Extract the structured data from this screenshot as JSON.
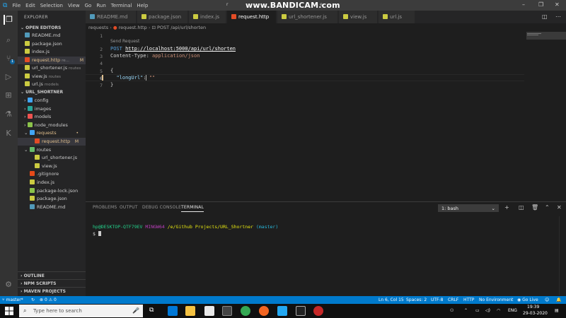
{
  "titlebar": {
    "menu": [
      "File",
      "Edit",
      "Selection",
      "View",
      "Go",
      "Run",
      "Terminal",
      "Help"
    ],
    "title_left": "r",
    "watermark": "www.BANDICAM.com",
    "title_right": "e",
    "minimize": "–",
    "maximize": "❐",
    "close": "✕"
  },
  "sidebar": {
    "header": "EXPLORER",
    "open_editors_title": "OPEN EDITORS",
    "open_editors": [
      {
        "name": "README.md",
        "detail": "",
        "icon_color": "#519aba",
        "mod": ""
      },
      {
        "name": "package.json",
        "detail": "",
        "icon_color": "#cbcb41",
        "mod": ""
      },
      {
        "name": "index.js",
        "detail": "",
        "icon_color": "#cbcb41",
        "mod": ""
      },
      {
        "name": "request.http",
        "detail": "re...",
        "icon_color": "#e34c26",
        "mod": "M"
      },
      {
        "name": "url_shortener.js",
        "detail": "routes",
        "icon_color": "#cbcb41",
        "mod": ""
      },
      {
        "name": "view.js",
        "detail": "routes",
        "icon_color": "#cbcb41",
        "mod": ""
      },
      {
        "name": "url.js",
        "detail": "models",
        "icon_color": "#cbcb41",
        "mod": ""
      }
    ],
    "project_title": "URL_SHORTNER",
    "tree": [
      {
        "name": "config",
        "icon_color": "#42a5f5",
        "mod": ""
      },
      {
        "name": "images",
        "icon_color": "#26a69a",
        "mod": ""
      },
      {
        "name": "models",
        "icon_color": "#ef5350",
        "mod": ""
      },
      {
        "name": "node_modules",
        "icon_color": "#8bc34a",
        "mod": ""
      },
      {
        "name": "requests",
        "icon_color": "#42a5f5",
        "mod": "•"
      },
      {
        "name": "request.http",
        "icon_color": "#e34c26",
        "mod": "M"
      },
      {
        "name": "routes",
        "icon_color": "#66bb6a",
        "mod": ""
      },
      {
        "name": "url_shortener.js",
        "icon_color": "#cbcb41",
        "mod": ""
      },
      {
        "name": "view.js",
        "icon_color": "#cbcb41",
        "mod": ""
      },
      {
        "name": ".gitignore",
        "icon_color": "#e64a19",
        "mod": ""
      },
      {
        "name": "index.js",
        "icon_color": "#cbcb41",
        "mod": ""
      },
      {
        "name": "package-lock.json",
        "icon_color": "#8bc34a",
        "mod": ""
      },
      {
        "name": "package.json",
        "icon_color": "#cbcb41",
        "mod": ""
      },
      {
        "name": "README.md",
        "icon_color": "#519aba",
        "mod": ""
      }
    ],
    "bottom_sections": [
      "OUTLINE",
      "NPM SCRIPTS",
      "MAVEN PROJECTS"
    ]
  },
  "tabs": [
    {
      "label": "README.md",
      "icon_color": "#519aba",
      "active": false
    },
    {
      "label": "package.json",
      "icon_color": "#cbcb41",
      "active": false
    },
    {
      "label": "index.js",
      "icon_color": "#cbcb41",
      "active": false
    },
    {
      "label": "request.http",
      "icon_color": "#e34c26",
      "active": true
    },
    {
      "label": "url_shortener.js",
      "icon_color": "#cbcb41",
      "active": false
    },
    {
      "label": "view.js",
      "icon_color": "#cbcb41",
      "active": false
    },
    {
      "label": "url.js",
      "icon_color": "#cbcb41",
      "active": false
    }
  ],
  "breadcrumb": [
    "requests",
    "request.http",
    "POST /api/url/shorten"
  ],
  "editor": {
    "codelens": "Send Request",
    "line_numbers": [
      "1",
      "2",
      "3",
      "4",
      "5",
      "6",
      "7"
    ],
    "line2_method": "POST",
    "line2_url": "http://localhost:5000/api/url/shorten",
    "line3_key": "Content-Type:",
    "line3_value": "application/json",
    "line5": "{",
    "line6_key": "\"longUrl\"",
    "line6_colon": ":",
    "line6_value": "\"\"",
    "line7": "}"
  },
  "panel": {
    "tabs": [
      "PROBLEMS",
      "OUTPUT",
      "DEBUG CONSOLE",
      "TERMINAL"
    ],
    "active_tab": "TERMINAL",
    "terminal_select": "1: bash",
    "term_user": "hp@DESKTOP-QTF79EV",
    "term_shell": "MINGW64",
    "term_path": "/e/Github Projects/URL_Shortner",
    "term_branch": "(master)",
    "term_prompt": "$"
  },
  "statusbar": {
    "branch": "master*",
    "errors": "0",
    "warnings": "0",
    "position": "Ln 6, Col 15",
    "spaces": "Spaces: 2",
    "encoding": "UTF-8",
    "eol": "CRLF",
    "language": "HTTP",
    "environment": "No Environment",
    "golive": "Go Live"
  },
  "taskbar": {
    "search_placeholder": "Type here to search",
    "lang": "ENG",
    "time": "19:39",
    "date": "29-03-2020"
  }
}
